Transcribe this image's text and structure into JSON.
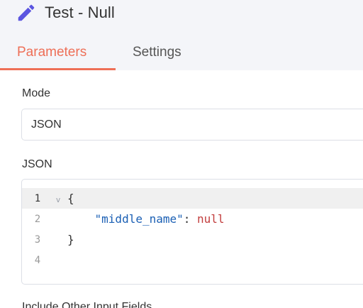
{
  "node": {
    "title": "Test - Null",
    "icon": "pencil-icon",
    "accent_color": "#ee6f57",
    "icon_color": "#5b55e0"
  },
  "tabs": [
    {
      "label": "Parameters",
      "active": true
    },
    {
      "label": "Settings",
      "active": false
    }
  ],
  "mode": {
    "label": "Mode",
    "value": "JSON"
  },
  "json_field": {
    "label": "JSON",
    "lines": [
      {
        "number": "1",
        "open": "{",
        "fold_marker": "v"
      },
      {
        "number": "2",
        "key": "\"middle_name\"",
        "sep": ": ",
        "value": "null"
      },
      {
        "number": "3",
        "close": "}"
      },
      {
        "number": "4"
      }
    ]
  },
  "next_field_label": "Include Other Input Fields"
}
